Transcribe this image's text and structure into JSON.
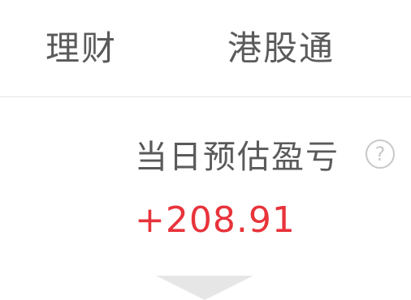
{
  "tabs": [
    {
      "label": "理财"
    },
    {
      "label": "港股通"
    }
  ],
  "pnl": {
    "label": "当日预估盈亏",
    "help_glyph": "?",
    "value": "+208.91"
  },
  "colors": {
    "text_primary": "#5a5a5a",
    "positive": "#e8333a",
    "divider": "#e3e3e3",
    "icon": "#c8c8c8",
    "arrow": "#e6e6e6"
  },
  "icons": {
    "help": "question-circle-icon",
    "expand": "triangle-down-icon"
  }
}
